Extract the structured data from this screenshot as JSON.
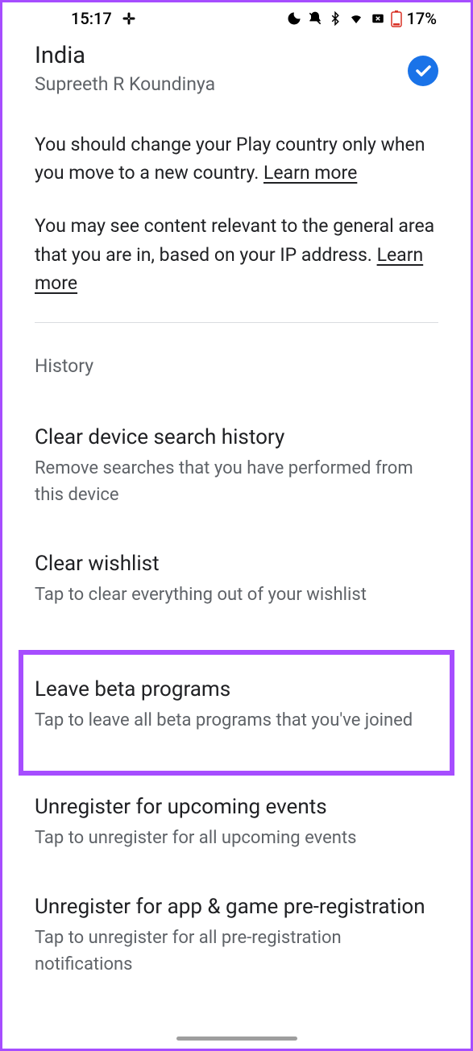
{
  "status": {
    "time": "15:17",
    "battery": "17%"
  },
  "country": {
    "name": "India",
    "account": "Supreeth R Koundinya"
  },
  "info1": {
    "text": "You should change your Play country only when you move to a new country. ",
    "link": "Learn more"
  },
  "info2": {
    "text": "You may see content relevant to the general area that you are in, based on your IP address. ",
    "link": "Learn more"
  },
  "history": {
    "label": "History"
  },
  "settings": {
    "clear_search": {
      "title": "Clear device search history",
      "desc": "Remove searches that you have performed from this device"
    },
    "clear_wishlist": {
      "title": "Clear wishlist",
      "desc": "Tap to clear everything out of your wishlist"
    },
    "leave_beta": {
      "title": "Leave beta programs",
      "desc": "Tap to leave all beta programs that you've joined"
    },
    "unregister_events": {
      "title": "Unregister for upcoming events",
      "desc": "Tap to unregister for all upcoming events"
    },
    "unregister_prereg": {
      "title": "Unregister for app & game pre-registration",
      "desc": "Tap to unregister for all pre-registration notifications"
    }
  }
}
